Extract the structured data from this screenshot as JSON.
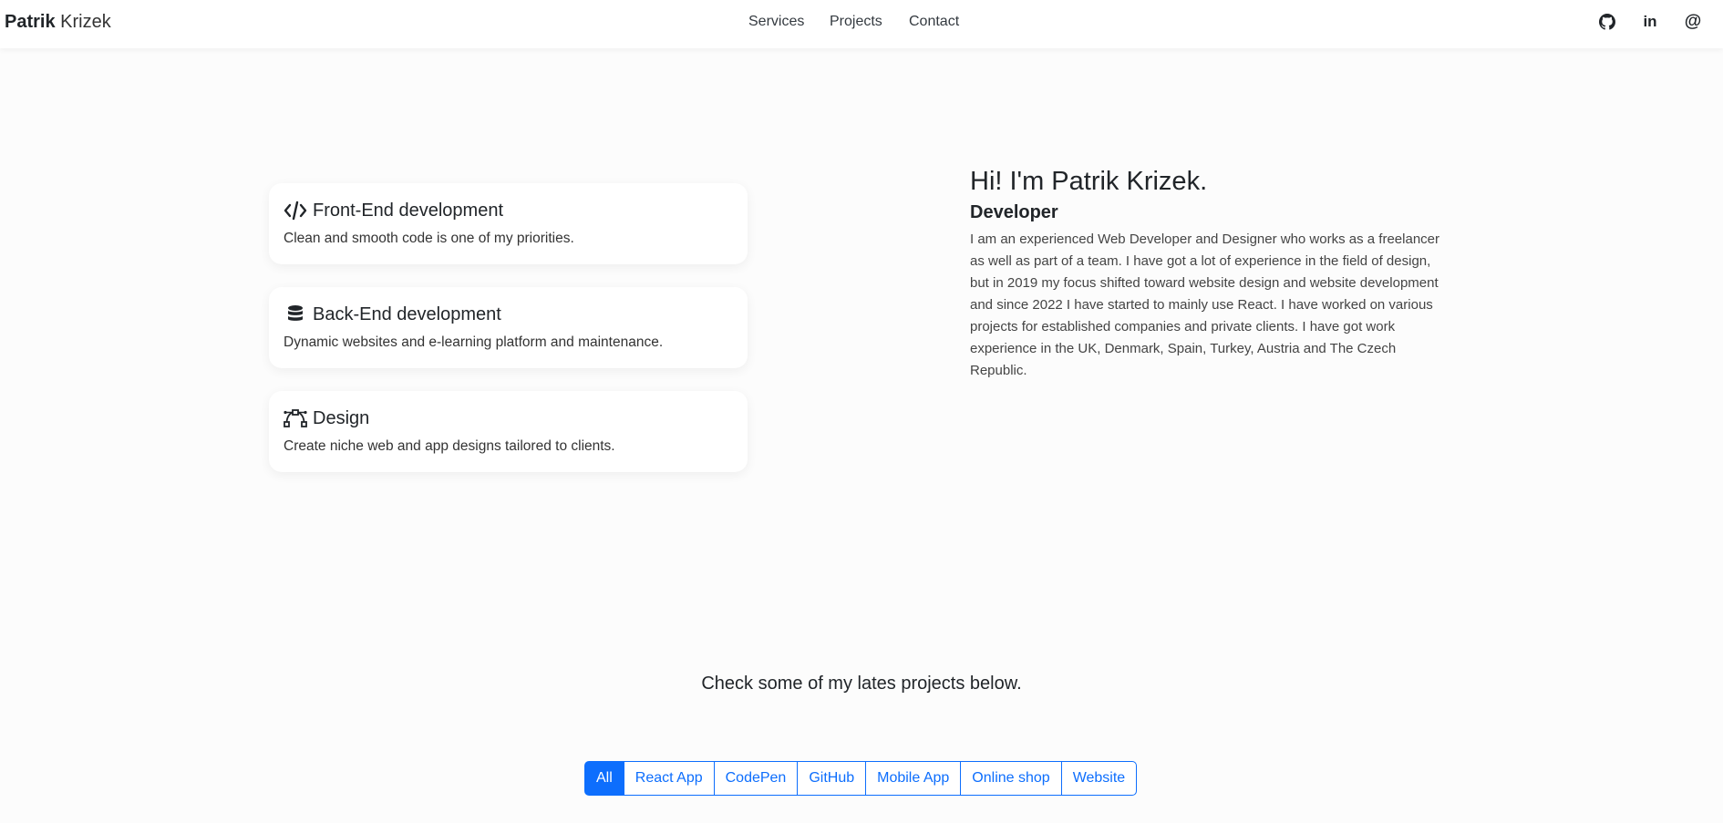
{
  "brand": {
    "first": "Patrik",
    "last": "Krizek"
  },
  "nav": {
    "services": "Services",
    "projects": "Projects",
    "contact": "Contact"
  },
  "social": {
    "github_icon": "github-icon",
    "linkedin_label": "in",
    "email_label": "@"
  },
  "services": [
    {
      "icon": "code-icon",
      "title": "Front-End development",
      "text": "Clean and smooth code is one of my priorities."
    },
    {
      "icon": "database-icon",
      "title": "Back-End development",
      "text": "Dynamic websites and e-learning platform and maintenance."
    },
    {
      "icon": "bezier-icon",
      "title": "Design",
      "text": "Create niche web and app designs tailored to clients."
    }
  ],
  "hero": {
    "title": "Hi! I'm Patrik Krizek.",
    "subtitle": "Developer",
    "text": "I am an experienced Web Developer and Designer who works as a freelancer as well as part of a team. I have got a lot of experience in the field of design, but in 2019 my focus shifted toward website design and website development and since 2022 I have started to mainly use React. I have worked on various projects for established companies and private clients. I have got work experience in the UK, Denmark, Spain, Turkey, Austria and The Czech Republic."
  },
  "projects": {
    "heading": "Check some of my lates projects below.",
    "filters": [
      "All",
      "React App",
      "CodePen",
      "GitHub",
      "Mobile App",
      "Online shop",
      "Website"
    ],
    "active_filter": "All"
  },
  "colors": {
    "accent": "#0d6efd",
    "background": "#fcfcfc",
    "card": "#ffffff"
  }
}
